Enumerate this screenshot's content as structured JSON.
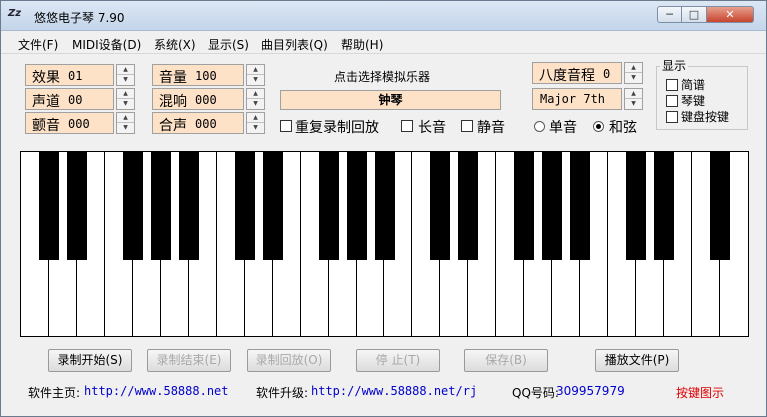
{
  "window": {
    "title": "悠悠电子琴 7.90",
    "controls": [
      "─",
      "□",
      "✕"
    ]
  },
  "menu": [
    "文件(F)",
    "MIDI设备(D)",
    "系统(X)",
    "显示(S)",
    "曲目列表(Q)",
    "帮助(H)"
  ],
  "params": {
    "effect": {
      "label": "效果",
      "value": "01"
    },
    "channel": {
      "label": "声道",
      "value": "00"
    },
    "vibrato": {
      "label": "颤音",
      "value": "000"
    },
    "volume": {
      "label": "音量",
      "value": "100"
    },
    "reverb": {
      "label": "混响",
      "value": "000"
    },
    "chorus": {
      "label": "合声",
      "value": "000"
    },
    "octave": {
      "label": "八度音程",
      "value": "0"
    },
    "chord": {
      "value": "Major 7th"
    }
  },
  "instrument": {
    "prompt": "点击选择模拟乐器",
    "name": "钟琴"
  },
  "options": {
    "repeat": "重复录制回放",
    "sustain": "长音",
    "mute": "静音",
    "single": "单音",
    "chord": "和弦"
  },
  "display": {
    "legend": "显示",
    "items": [
      "简谱",
      "琴键",
      "键盘按键"
    ]
  },
  "buttons": {
    "record_start": "录制开始(S)",
    "record_end": "录制结束(E)",
    "playback": "录制回放(O)",
    "stop": "停 止(T)",
    "save": "保存(B)",
    "play_file": "播放文件(P)"
  },
  "footer": {
    "home_label": "软件主页:",
    "home_url": "http://www.58888.net",
    "upgrade_label": "软件升级:",
    "upgrade_url": "http://www.58888.net/rj",
    "qq_label": "QQ号码:",
    "qq_value": "309957979",
    "hint": "按键图示"
  }
}
